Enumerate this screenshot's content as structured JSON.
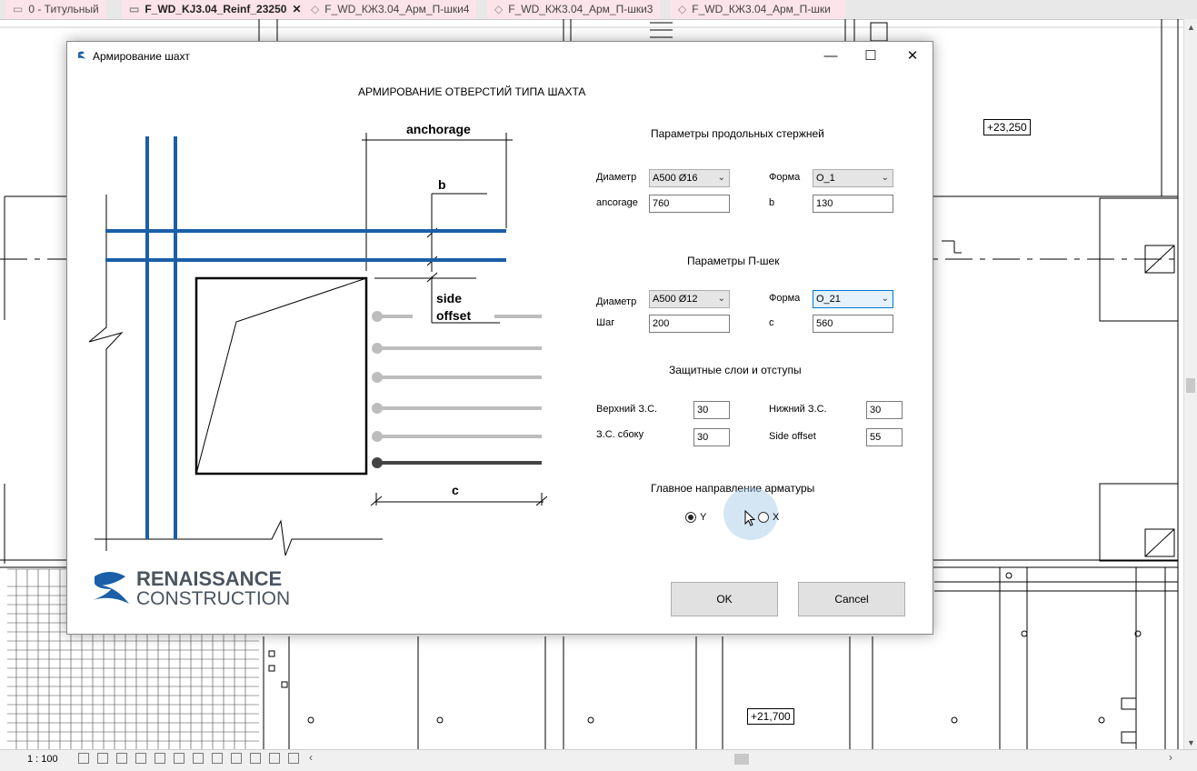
{
  "tabs": [
    {
      "label": "0 - Титульный",
      "active": false
    },
    {
      "label": "F_WD_KJ3.04_Reinf_23250",
      "active": true,
      "close": "✕"
    },
    {
      "label": "F_WD_КЖ3.04_Арм_П-шки4",
      "active": false
    },
    {
      "label": "F_WD_КЖ3.04_Арм_П-шки3",
      "active": false
    },
    {
      "label": "F_WD_КЖ3.04_Арм_П-шки",
      "active": false
    }
  ],
  "drawing": {
    "level_tags": [
      "+23,250",
      "+21,700"
    ]
  },
  "status": {
    "scale": "1 : 100"
  },
  "dialog": {
    "title": "Армирование шахт",
    "window_buttons": {
      "minimize": "—",
      "maximize": "☐",
      "close": "✕"
    },
    "heading": "АРМИРОВАНИЕ ОТВЕРСТИЙ ТИПА ШАХТА",
    "sketch_labels": {
      "anchorage": "anchorage",
      "b": "b",
      "side": "side",
      "offset": "offset",
      "c": "c"
    },
    "logo": {
      "line1": "RENAISSANCE",
      "line2": "CONSTRUCTION"
    },
    "longitudinal": {
      "heading": "Параметры продольных стержней",
      "diameter_label": "Диаметр",
      "diameter_value": "A500 Ø16",
      "form_label": "Форма",
      "form_value": "O_1",
      "anchorage_label": "ancorage",
      "anchorage_value": "760",
      "b_label": "b",
      "b_value": "130"
    },
    "pshki": {
      "heading": "Параметры П-шек",
      "diameter_label": "Диаметр",
      "diameter_value": "A500 Ø12",
      "form_label": "Форма",
      "form_value": "O_21",
      "step_label": "Шаг",
      "step_value": "200",
      "c_label": "c",
      "c_value": "560"
    },
    "cover": {
      "heading": "Защитные слои и отступы",
      "top_label": "Верхний З.С.",
      "top_value": "30",
      "bottom_label": "Нижний З.С.",
      "bottom_value": "30",
      "side_label": "З.С. сбоку",
      "side_value": "30",
      "offset_label": "Side offset",
      "offset_value": "55"
    },
    "direction": {
      "heading": "Главное направление арматуры",
      "options": [
        {
          "label": "Y",
          "checked": true
        },
        {
          "label": "X",
          "checked": false
        }
      ]
    },
    "buttons": {
      "ok": "OK",
      "cancel": "Cancel"
    }
  },
  "colors": {
    "rebar_blue": "#1a5fa8",
    "tab_pink": "#fde3ea",
    "accent": "#0078d7"
  }
}
